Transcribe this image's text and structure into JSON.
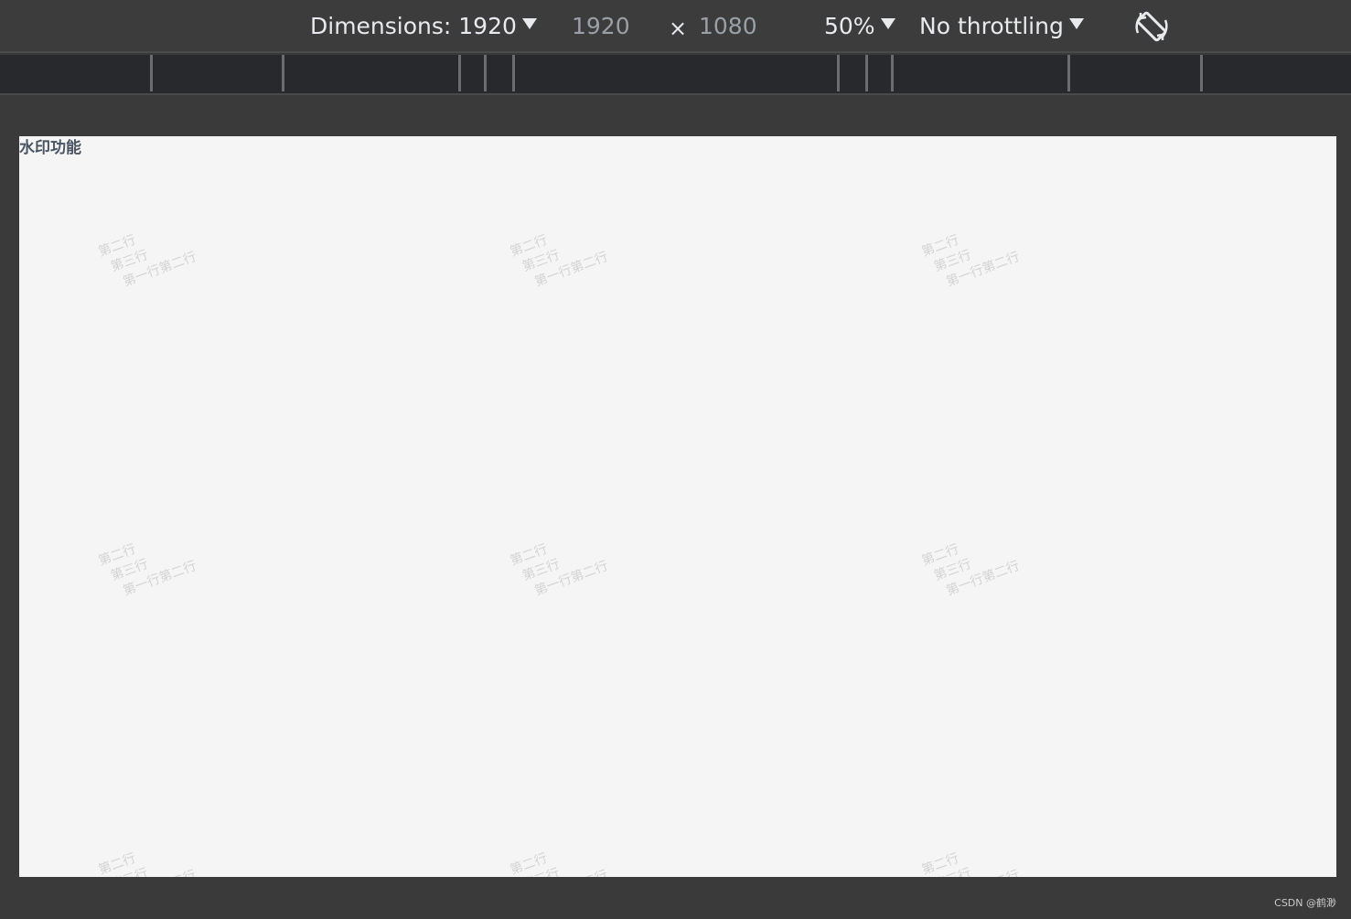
{
  "toolbar": {
    "dimensions_label": "Dimensions: 1920",
    "width_value": "1920",
    "times_symbol": "×",
    "height_value": "1080",
    "zoom_label": "50%",
    "throttle_label": "No throttling",
    "rotate_icon": "rotate-icon"
  },
  "page": {
    "heading": "水印功能",
    "watermark": {
      "line1": "第二行",
      "line2": "第三行",
      "line3": "第一行第二行"
    }
  },
  "footer": {
    "credit": "CSDN @鹤渺"
  }
}
